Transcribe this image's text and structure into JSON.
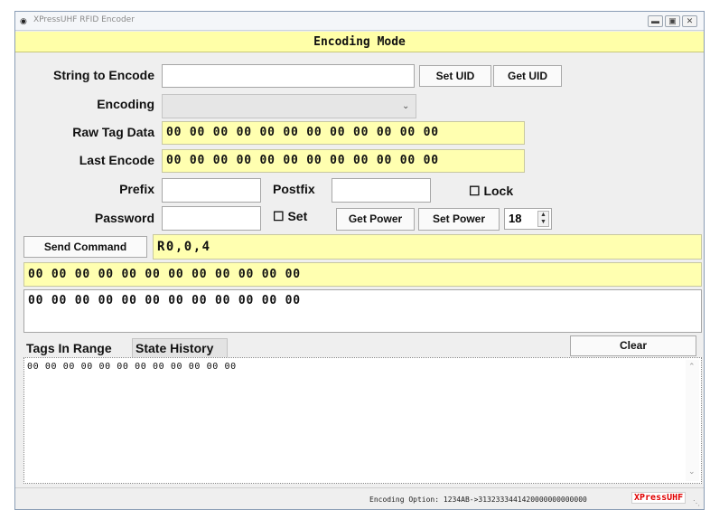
{
  "window": {
    "title": "XPressUHF RFID Encoder"
  },
  "header": {
    "title": "Encoding Mode"
  },
  "form": {
    "string_label": "String to Encode",
    "string_value": "",
    "set_uid": "Set UID",
    "get_uid": "Get UID",
    "encoding_label": "Encoding",
    "encoding_value": "",
    "raw_label": "Raw Tag Data",
    "raw_value": "00 00 00 00 00 00 00 00 00 00 00 00",
    "last_label": "Last Encode",
    "last_value": "00 00 00 00 00 00 00 00 00 00 00 00",
    "prefix_label": "Prefix",
    "prefix_value": "",
    "postfix_label": "Postfix",
    "postfix_value": "",
    "lock_label": "Lock",
    "password_label": "Password",
    "password_value": "",
    "set_label": "Set",
    "get_power": "Get Power",
    "set_power": "Set Power",
    "power_value": "18"
  },
  "command": {
    "send_label": "Send Command",
    "value": "R0,0,4",
    "response_yellow": "00 00 00 00 00 00 00 00 00 00 00 00",
    "response_white": "00 00 00 00 00 00 00 00 00 00 00 00"
  },
  "tabs": {
    "tags_in_range": "Tags In Range",
    "state_history": "State History"
  },
  "clear_label": "Clear",
  "log": {
    "line1": "00 00 00 00 00 00 00 00 00 00 00 00"
  },
  "status": {
    "encoding_option": "Encoding Option: 1234AB->3132333441420000000000000",
    "brand": "XPressUHF"
  },
  "colors": {
    "yellow": "#ffffa8",
    "brand_red": "#e00000"
  }
}
